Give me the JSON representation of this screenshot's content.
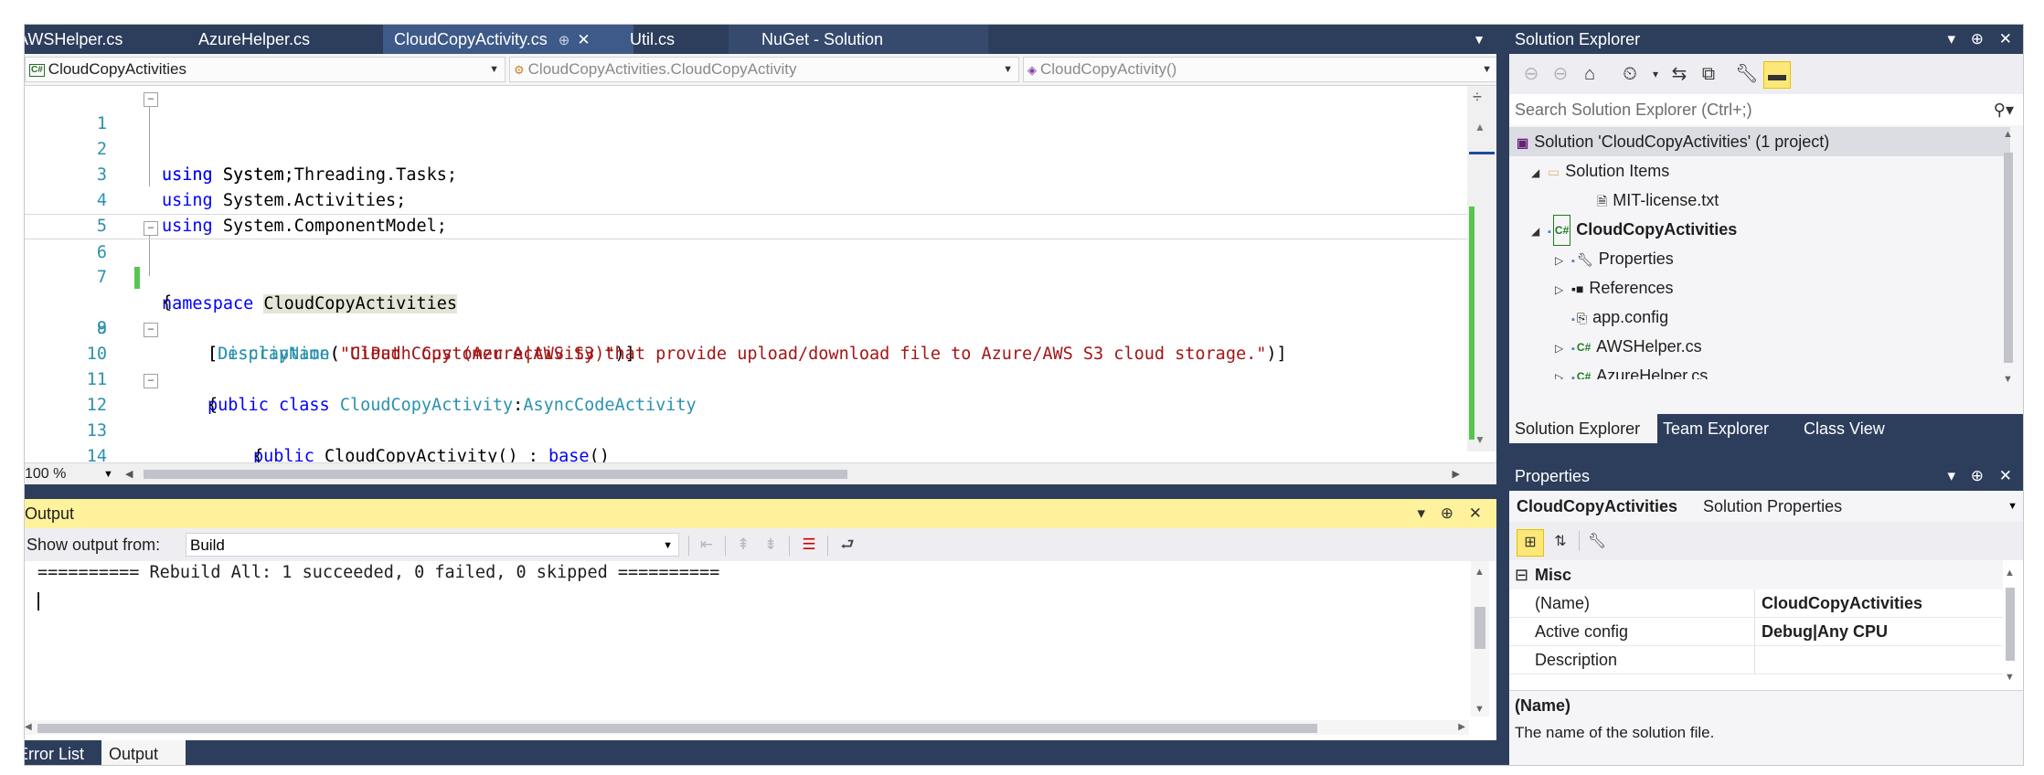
{
  "editor": {
    "tabs": [
      {
        "label": "AWSHelper.cs"
      },
      {
        "label": "AzureHelper.cs"
      },
      {
        "label": "CloudCopyActivity.cs",
        "pin": "⊕",
        "close": "✕"
      },
      {
        "label": "Util.cs"
      },
      {
        "label": "NuGet - Solution"
      }
    ],
    "nav": {
      "project": "CloudCopyActivities",
      "type": "CloudCopyActivities.CloudCopyActivity",
      "member": "CloudCopyActivity()"
    },
    "zoom": "100 %",
    "lines": [
      {
        "n": "1"
      },
      {
        "n": "2"
      },
      {
        "n": "3"
      },
      {
        "n": "4"
      },
      {
        "n": "5"
      },
      {
        "n": "6"
      },
      {
        "n": "7"
      },
      {
        "n": "8"
      },
      {
        "n": "9"
      },
      {
        "n": "10"
      },
      {
        "n": "11"
      },
      {
        "n": "12"
      },
      {
        "n": "13"
      },
      {
        "n": "14"
      }
    ],
    "code": {
      "using": "using",
      "l1": " System;",
      "l2": " System.Threading.Tasks;",
      "l3": " System.Activities;",
      "l4": " System.ComponentModel;",
      "namespace_kw": "namespace",
      "namespace_name": "CloudCopyActivities",
      "brace_open": "{",
      "brace_close": "}",
      "l8_a": "[",
      "l8_attr": "DisplayName",
      "l8_b": "(",
      "l8_str": "\"Cloud Copy (Azure|AWS S3)\"",
      "l8_c": ")]",
      "l9_a": "[",
      "l9_attr": "Description",
      "l9_b": "(",
      "l9_str": "\"UiPath Customer Activity that provide upload/download file to Azure/AWS S3 cloud storage.\"",
      "l9_c": ")]",
      "l10_public": "public",
      "l10_class": "class",
      "l10_name": "CloudCopyActivity",
      "l10_colon": ":",
      "l10_base": "AsyncCodeActivity",
      "l12_public": "public",
      "l12_sig": " CloudCopyActivity() : ",
      "l12_base": "base",
      "l12_end": "()"
    }
  },
  "output": {
    "title": "Output",
    "controls": "▾ ⊕ ✕",
    "show_from_label": "Show output from:",
    "source": "Build",
    "text": "========== Rebuild All: 1 succeeded, 0 failed, 0 skipped =========="
  },
  "bottom_tabs": [
    {
      "label": "Error List"
    },
    {
      "label": "Output"
    }
  ],
  "solution_explorer": {
    "title": "Solution Explorer",
    "controls": "▾ ⊕ ✕",
    "search_placeholder": "Search Solution Explorer (Ctrl+;)",
    "tree": {
      "solution": "Solution 'CloudCopyActivities' (1 project)",
      "solution_items": "Solution Items",
      "license": "MIT-license.txt",
      "project": "CloudCopyActivities",
      "properties": "Properties",
      "references": "References",
      "app_config": "app.config",
      "aws_helper": "AWSHelper.cs",
      "azure_helper": "AzureHelper.cs"
    },
    "tabs": [
      {
        "label": "Solution Explorer"
      },
      {
        "label": "Team Explorer"
      },
      {
        "label": "Class View"
      }
    ]
  },
  "properties": {
    "title": "Properties",
    "controls": "▾ ⊕ ✕",
    "object_name": "CloudCopyActivities",
    "object_type": "Solution Properties",
    "category": "Misc",
    "rows": [
      {
        "key": "(Name)",
        "value": "CloudCopyActivities"
      },
      {
        "key": "Active config",
        "value": "Debug|Any CPU"
      },
      {
        "key": "Description",
        "value": ""
      }
    ],
    "desc_title": "(Name)",
    "desc_text": "The name of the solution file."
  },
  "colors": {
    "chrome_dark": "#2d3e5c",
    "output_title_bg": "#fff29d",
    "keyword": "#0000ff",
    "type": "#2b91af",
    "string": "#a31515"
  }
}
